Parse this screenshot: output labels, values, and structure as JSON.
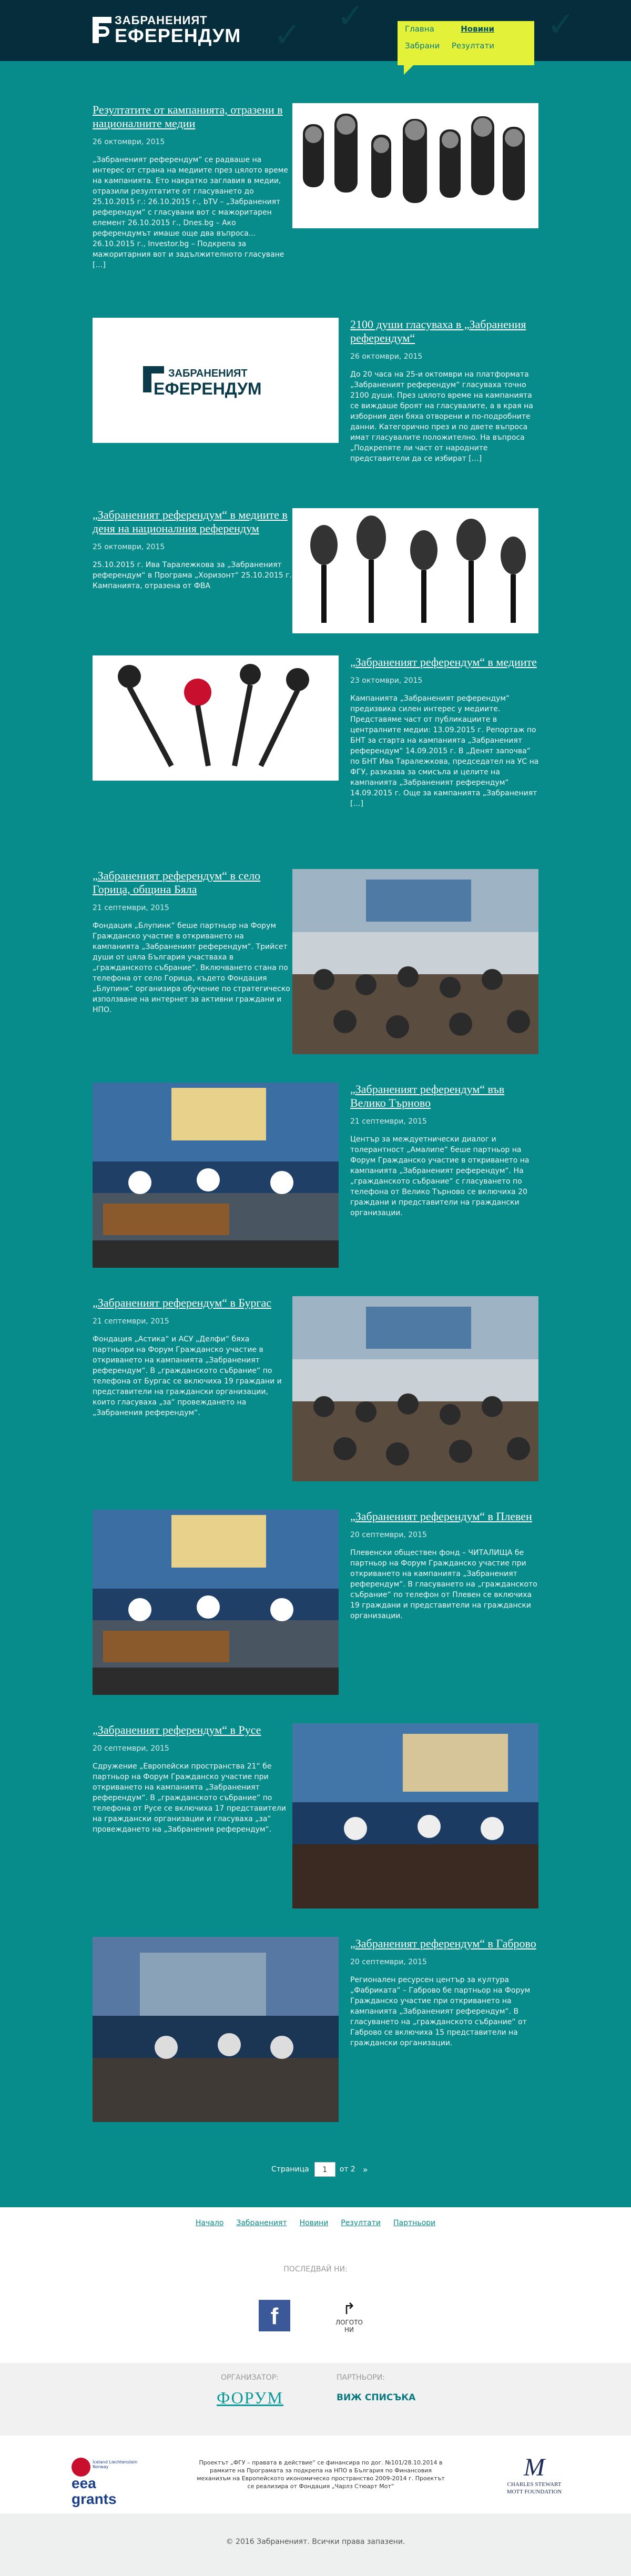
{
  "header": {
    "logo_line1": "ЗАБРАНЕНИЯТ",
    "logo_line2": "ЕФЕРЕНДУМ",
    "nav": [
      {
        "label": "Главна",
        "active": false
      },
      {
        "label": "Новини",
        "active": true
      },
      {
        "label": "Забрани",
        "active": false
      },
      {
        "label": "Резултати",
        "active": false
      }
    ]
  },
  "posts": [
    {
      "title": "Резултатите от кампанията, отразени в националните медии",
      "date": "26 октомври, 2015",
      "excerpt": "„Забраненият референдум“ се радваше на интерес от страна на медиите през цялото време на кампанията. Ето накратко заглавия в медии, отразили резултатите от гласуването до 25.10.2015 г.: 26.10.2015 г., bTV – „Забраненият референдум“ с гласувани вот с мажоритарен елемент 26.10.2015 г., Dnes.bg – Ако референдумът имаше още два въпроса… 26.10.2015 г., Investor.bg – Подкрепа за мажоритарния вот и задължителното гласуване […]",
      "image": "microphones"
    },
    {
      "title": "2100 души гласуваха в „Забранения референдум“",
      "date": "26 октомври, 2015",
      "excerpt": "До 20 часа на 25-и октомври на платформата „Забраненият референдум“ гласуваха точно 2100 души. През цялото време на кампанията се виждаше броят на гласувалите, а в края на изборния ден бяха отворени и по-подробните данни. Категорично през и по двете въпроса имат гласувалите положително. На въпроса „Подкрепяте ли част от народните представители да се избират […]",
      "image": "logo"
    },
    {
      "title": "„Забраненият референдум“ в медиите в деня на националния референдум",
      "date": "25 октомври, 2015",
      "excerpt": "25.10.2015 г. Ива Таралежкова за „Забраненият референдум“ в Програма „Хоризонт“ 25.10.2015 г. Кампанията, отразена от ФВА",
      "image": "microphones2"
    },
    {
      "title": "„Забраненият референдум“ в медиите",
      "date": "23 октомври, 2015",
      "excerpt": "Кампанията „Забраненият референдум“ предизвика силен интерес у медиите. Представяме част от публикациите в централните медии: 13.09.2015 г. Репортаж по БНТ за старта на кампанията „Забраненият референдум“ 14.09.2015 г. В „Денят започва“ по БНТ Ива Таралежкова, председател на УС на ФГУ, разказва за смисъла и целите на кампанията „Забраненият референдум“ 14.09.2015 г. Още за кампанията „Забраненият […]",
      "image": "microphones3"
    },
    {
      "title": "„Забраненият референдум“ в село Горица, община Бяла",
      "date": "21 септември, 2015",
      "excerpt": "Фондация „Блупинк“ беше партньор на Форум Гражданско участие в откриването на кампанията „Забраненият референдум“. Трийсет души от цяла България участваха в „гражданското събрание“. Включването стана по телефона от село Горица, където Фондация „Блупинк“ организира обучение по стратегическо използване на интернет за активни граждани и НПО.",
      "image": "conference"
    },
    {
      "title": "„Забраненият референдум“ във Велико Търново",
      "date": "21 септември, 2015",
      "excerpt": "Център за междуетнически диалог и толерантност „Амалипе“ беше партньор на Форум Гражданско участие в откриването на кампанията „Забраненият референдум“. На „гражданското събрание“ с гласуването по телефона от Велико Търново се включиха 20 граждани и представители на граждански организации.",
      "image": "press"
    },
    {
      "title": "„Забраненият референдум“ в Бургас",
      "date": "21 септември, 2015",
      "excerpt": "Фондация „Астика“ и АСУ „Делфи“ бяха партньори на Форум Гражданско участие в откриването на кампанията „Забраненият референдум“. В „гражданското събрание“ по телефона от Бургас се включиха 19 граждани и представители на граждански организации, които гласуваха „за“ провеждането на „Забранения референдум“.",
      "image": "conference"
    },
    {
      "title": "„Забраненият референдум“ в Плевен",
      "date": "20 септември, 2015",
      "excerpt": "Плевенски обществен фонд – ЧИТАЛИЩА бе партньор на Форум Гражданско участие при откриването на кампанията „Забраненият референдум“. В гласуването на „гражданското събрание“ по телефон от Плевен се включиха 19 граждани и представители на граждански организации.",
      "image": "press"
    },
    {
      "title": "„Забраненият референдум“ в Русе",
      "date": "20 септември, 2015",
      "excerpt": "Сдружение „Европейски пространства 21“ бе партньор на Форум Гражданско участие при откриването на кампанията „Забраненият референдум“. В „гражданското събрание“ по телефона от Русе се включиха 17 представители на граждански организации и гласуваха „за“ провеждането на „Забранения референдум“.",
      "image": "press2"
    },
    {
      "title": "„Забраненият референдум“ в Габрово",
      "date": "20 септември, 2015",
      "excerpt": "Регионален ресурсен център за култура „Фабриката“ – Габрово бе партньор на Форум Гражданско участие при откриването на кампанията „Забраненият референдум“. В гласуването на „гражданското събрание“ от Габрово се включиха 15 представители на граждански организации.",
      "image": "press3"
    }
  ],
  "pager": {
    "label": "Страница",
    "current": "1",
    "of": "от 2",
    "next": "»"
  },
  "footer": {
    "links": [
      "Начало",
      "Забраненият",
      "Новини",
      "Резултати",
      "Партньори"
    ],
    "follow": "ПОСЛЕДВАЙ НИ:",
    "fb": "f",
    "sn_label": "ЛОГОТО НИ",
    "organizer_h": "ОРГАНИЗАТОР:",
    "organizer": "ФОРУМ",
    "partners_h": "ПАРТНЬОРИ:",
    "partners": "ВИЖ СПИСЪКА",
    "eea": "eea grants",
    "eea_small": "Iceland Liechtenstein Norway",
    "ad_text": "Проектът „ФГУ – правата в действие“ се финансира по дог. №101/28.10.2014 в рамките на Програмата за подкрепа на НПО в България по Финансовия механизъм на Европейското икономическо пространство 2009-2014 г. Проектът се реализира от Фондация „Чарлз Стюарт Мот“",
    "mott": "CHARLES STEWART MOTT FOUNDATION",
    "mott_mark": "M",
    "copyright": "© 2016 Забраненият. Всички права запазени."
  },
  "colors": {
    "bg": "#078b8b",
    "header": "#062d3b",
    "nav": "#e3f239"
  }
}
